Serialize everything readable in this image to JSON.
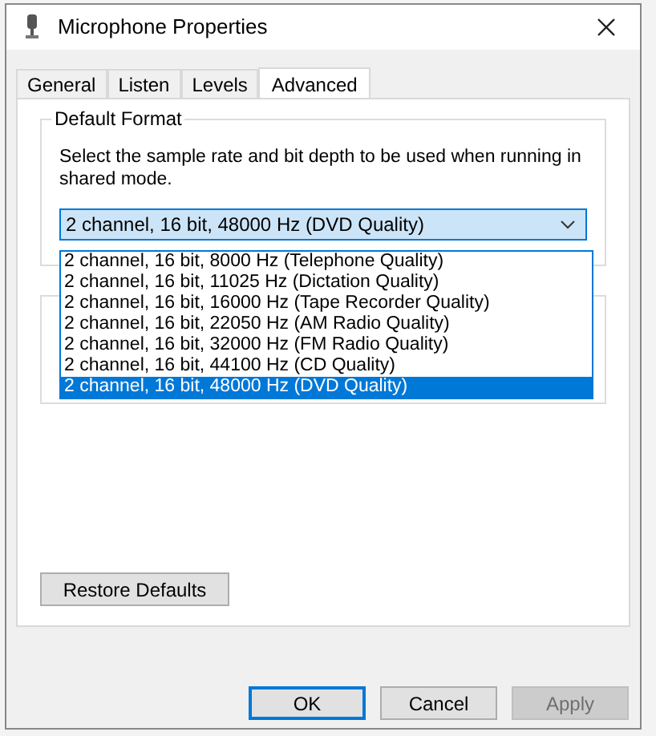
{
  "window": {
    "title": "Microphone Properties"
  },
  "tabs": [
    {
      "label": "General",
      "selected": false
    },
    {
      "label": "Listen",
      "selected": false
    },
    {
      "label": "Levels",
      "selected": false
    },
    {
      "label": "Advanced",
      "selected": true
    }
  ],
  "default_format": {
    "title": "Default Format",
    "description": "Select the sample rate and bit depth to be used when running in shared mode.",
    "combo": {
      "value": "2 channel, 16 bit, 48000 Hz (DVD Quality)",
      "expanded": true
    },
    "options": [
      {
        "label": "2 channel, 16 bit, 8000 Hz (Telephone Quality)",
        "selected": false
      },
      {
        "label": "2 channel, 16 bit, 11025 Hz (Dictation Quality)",
        "selected": false
      },
      {
        "label": "2 channel, 16 bit, 16000 Hz (Tape Recorder Quality)",
        "selected": false
      },
      {
        "label": "2 channel, 16 bit, 22050 Hz (AM Radio Quality)",
        "selected": false
      },
      {
        "label": "2 channel, 16 bit, 32000 Hz (FM Radio Quality)",
        "selected": false
      },
      {
        "label": "2 channel, 16 bit, 44100 Hz (CD Quality)",
        "selected": false
      },
      {
        "label": "2 channel, 16 bit, 48000 Hz (DVD Quality)",
        "selected": true
      }
    ]
  },
  "restore_button": "Restore Defaults",
  "footer_buttons": [
    {
      "label": "OK",
      "default": true,
      "disabled": false
    },
    {
      "label": "Cancel",
      "default": false,
      "disabled": false
    },
    {
      "label": "Apply",
      "default": false,
      "disabled": true
    }
  ]
}
